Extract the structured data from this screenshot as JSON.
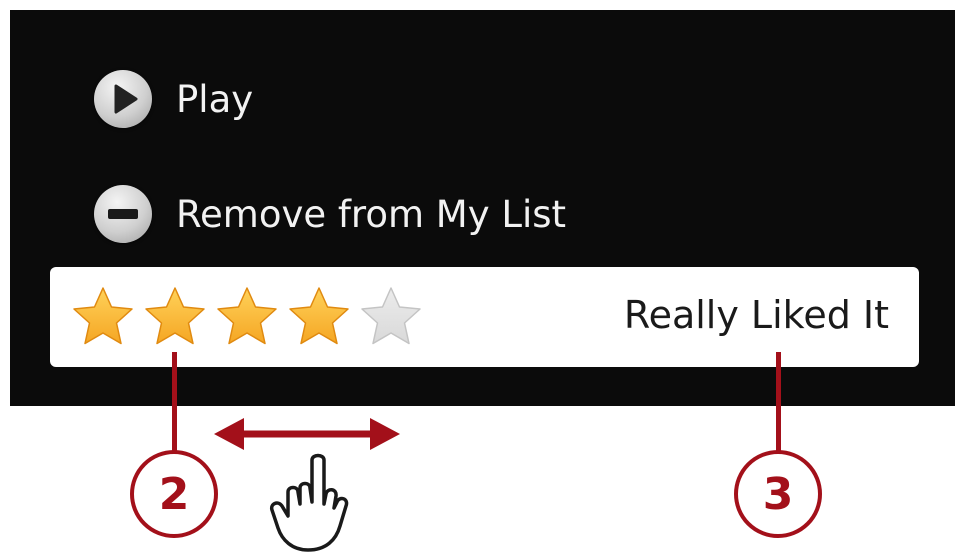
{
  "menu": {
    "play": {
      "label": "Play",
      "icon": "play-icon"
    },
    "remove": {
      "label": "Remove from My List",
      "icon": "minus-icon"
    }
  },
  "rating": {
    "stars_total": 5,
    "stars_filled": 4,
    "label": "Really Liked It",
    "filled_color": "#f5a623",
    "empty_color": "#d9d9d9"
  },
  "callouts": [
    {
      "number": "2",
      "target": "stars"
    },
    {
      "number": "3",
      "target": "rating-label"
    }
  ],
  "gesture": {
    "icon": "swipe-hand-icon",
    "arrow": "double-arrow-icon"
  },
  "colors": {
    "screen_bg": "#0b0b0b",
    "callout": "#a3101a",
    "menu_text": "#f2f2f2"
  }
}
